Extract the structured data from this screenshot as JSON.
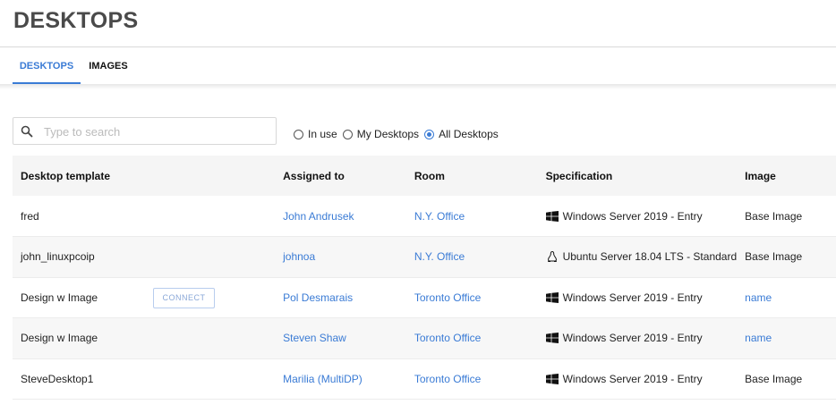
{
  "header": {
    "title": "DESKTOPS"
  },
  "tabs": [
    {
      "label": "DESKTOPS",
      "active": true
    },
    {
      "label": "IMAGES",
      "active": false
    }
  ],
  "search": {
    "placeholder": "Type to search",
    "value": ""
  },
  "filters": {
    "options": [
      {
        "label": "In use",
        "checked": false
      },
      {
        "label": "My Desktops",
        "checked": false
      },
      {
        "label": "All Desktops",
        "checked": true
      }
    ]
  },
  "table": {
    "columns": [
      "Desktop template",
      "Assigned to",
      "Room",
      "Specification",
      "Image"
    ],
    "connect_label": "CONNECT",
    "rows": [
      {
        "template": "fred",
        "assigned": "John Andrusek",
        "room": "N.Y. Office",
        "os_icon": "windows-icon",
        "spec": "Windows Server 2019 - Entry",
        "image": "Base Image",
        "image_link": false
      },
      {
        "template": "john_linuxpcoip",
        "assigned": "johnoa",
        "room": "N.Y. Office",
        "os_icon": "linux-icon",
        "spec": "Ubuntu Server 18.04 LTS - Standard",
        "image": "Base Image",
        "image_link": false
      },
      {
        "template": "Design w Image",
        "assigned": "Pol Desmarais",
        "room": "Toronto Office",
        "os_icon": "windows-icon",
        "spec": "Windows Server 2019 - Entry",
        "image": "name",
        "image_link": true,
        "hover": true
      },
      {
        "template": "Design w Image",
        "assigned": "Steven Shaw",
        "room": "Toronto Office",
        "os_icon": "windows-icon",
        "spec": "Windows Server 2019 - Entry",
        "image": "name",
        "image_link": true
      },
      {
        "template": "SteveDesktop1",
        "assigned": "Marilia (MultiDP)",
        "room": "Toronto Office",
        "os_icon": "windows-icon",
        "spec": "Windows Server 2019 - Entry",
        "image": "Base Image",
        "image_link": false
      }
    ]
  },
  "colors": {
    "accent": "#3a7bd5",
    "title": "#4a4a4a"
  }
}
